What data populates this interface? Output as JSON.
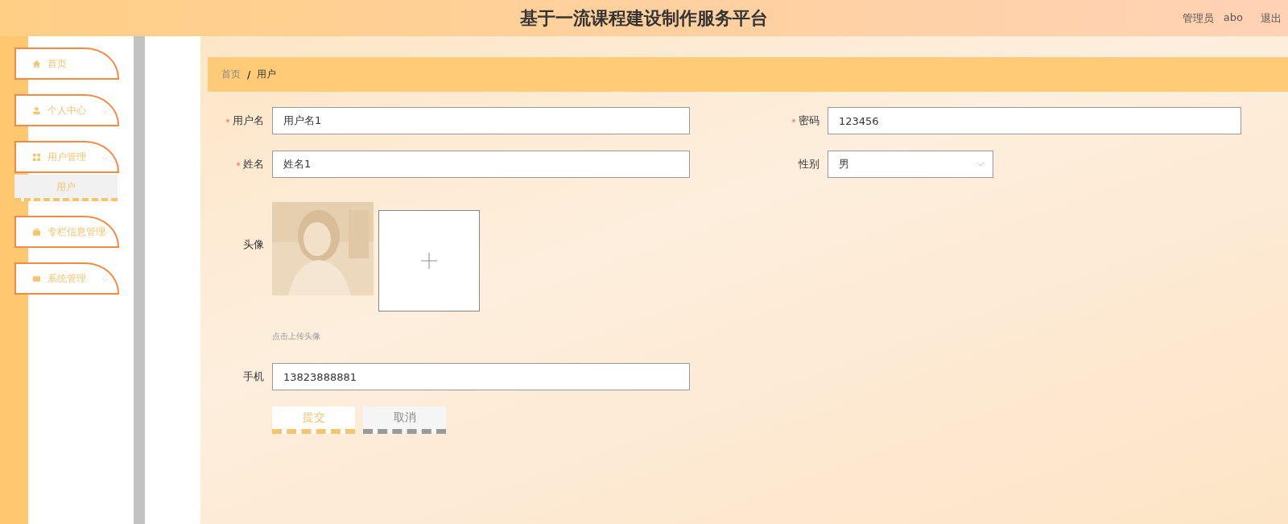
{
  "header": {
    "title": "基于一流课程建设制作服务平台",
    "user_role": "管理员",
    "user_name": "abo",
    "logout": "退出"
  },
  "sidebar": {
    "items": [
      {
        "label": "首页",
        "expandable": false
      },
      {
        "label": "个人中心",
        "expandable": true
      },
      {
        "label": "用户管理",
        "expandable": true,
        "children": [
          {
            "label": "用户",
            "selected": true
          }
        ]
      },
      {
        "label": "专栏信息管理",
        "expandable": true
      },
      {
        "label": "系统管理",
        "expandable": true
      }
    ]
  },
  "breadcrumb": {
    "items": [
      "首页",
      "用户"
    ],
    "separator": "/"
  },
  "form": {
    "rows": [
      [
        {
          "kind": "text",
          "label": "用户名",
          "required": true,
          "value": "用户名1"
        },
        {
          "kind": "text",
          "label": "密码",
          "required": true,
          "value": "123456"
        }
      ],
      [
        {
          "kind": "text",
          "label": "姓名",
          "required": true,
          "value": "姓名1"
        },
        {
          "kind": "select",
          "label": "性别",
          "required": false,
          "value": "男"
        }
      ],
      [
        {
          "kind": "upload",
          "label": "头像",
          "required": false,
          "hint": "点击上传头像"
        }
      ],
      [
        {
          "kind": "text",
          "label": "手机",
          "required": false,
          "value": "13823888881"
        }
      ]
    ],
    "buttons": [
      {
        "label": "提交",
        "kind": "primary"
      },
      {
        "label": "取消",
        "kind": "secondary"
      }
    ]
  }
}
